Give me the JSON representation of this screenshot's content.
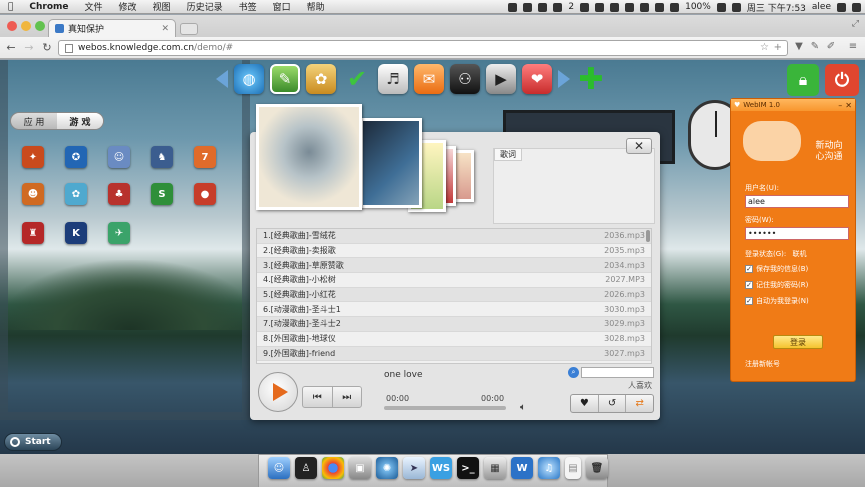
{
  "menubar": {
    "apple": "",
    "items": [
      "Chrome",
      "文件",
      "修改",
      "视图",
      "历史记录",
      "书签",
      "窗口",
      "帮助"
    ],
    "status_count": "2",
    "battery": "100%",
    "clock": "周三 下午7:53",
    "user": "alee"
  },
  "browser": {
    "tab_title": "真知保护",
    "url_domain": "webos.knowledge.com.cn",
    "url_path": "/demo/#"
  },
  "desktop": {
    "segment": {
      "apps": "应 用",
      "games": "游 戏",
      "active": "games"
    },
    "start_label": "Start",
    "top_dock_icons": [
      "browser-icon",
      "tools-icon",
      "paint-icon",
      "check-icon",
      "media-icon",
      "chat-icon",
      "gamepad-icon",
      "video-icon",
      "gallery-icon",
      "arrow-right-icon",
      "plus-icon"
    ],
    "game_icons": [
      [
        "game-1",
        "game-2",
        "game-3",
        "game-4",
        "game-5"
      ],
      [
        "game-6",
        "game-7",
        "game-8",
        "game-9",
        "game-10"
      ],
      [
        "game-11",
        "game-12",
        "game-13"
      ]
    ]
  },
  "player": {
    "lyrics_tab": "歌词",
    "close": "✕",
    "playlist": [
      {
        "title": "1.[经典歌曲]-雪绒花",
        "file": "2036.mp3"
      },
      {
        "title": "2.[经典歌曲]-卖报歌",
        "file": "2035.mp3"
      },
      {
        "title": "3.[经典歌曲]-草原赞歌",
        "file": "2034.mp3"
      },
      {
        "title": "4.[经典歌曲]-小松树",
        "file": "2027.MP3"
      },
      {
        "title": "5.[经典歌曲]-小红花",
        "file": "2026.mp3"
      },
      {
        "title": "6.[动漫歌曲]-圣斗士1",
        "file": "3030.mp3"
      },
      {
        "title": "7.[动漫歌曲]-圣斗士2",
        "file": "3029.mp3"
      },
      {
        "title": "8.[外国歌曲]-地球仪",
        "file": "3028.mp3"
      },
      {
        "title": "9.[外国歌曲]-friend",
        "file": "3027.mp3"
      }
    ],
    "now_playing": "one love",
    "time_current": "00:00",
    "time_total": "00:00",
    "progress": 0,
    "fav_label": "人喜欢"
  },
  "webim": {
    "title": "WebIM 1.0",
    "slogan": "新动向\n心沟通",
    "username_label": "用户名(U):",
    "username_value": "alee",
    "password_label": "密码(W):",
    "password_value": "••••••",
    "status_label": "登录状态(G):",
    "status_value": "联机",
    "options": [
      "保存我的信息(B)",
      "记住我的密码(R)",
      "自动为我登录(N)"
    ],
    "login_button": "登录",
    "register_link": "注册新帐号"
  },
  "dock_bottom": [
    "finder-icon",
    "qq-icon",
    "chrome-icon",
    "preview-icon",
    "network-icon",
    "mail-icon",
    "ws-icon",
    "terminal-icon",
    "photos-icon",
    "word-icon",
    "itunes-icon",
    "document-icon",
    "trash-icon"
  ]
}
